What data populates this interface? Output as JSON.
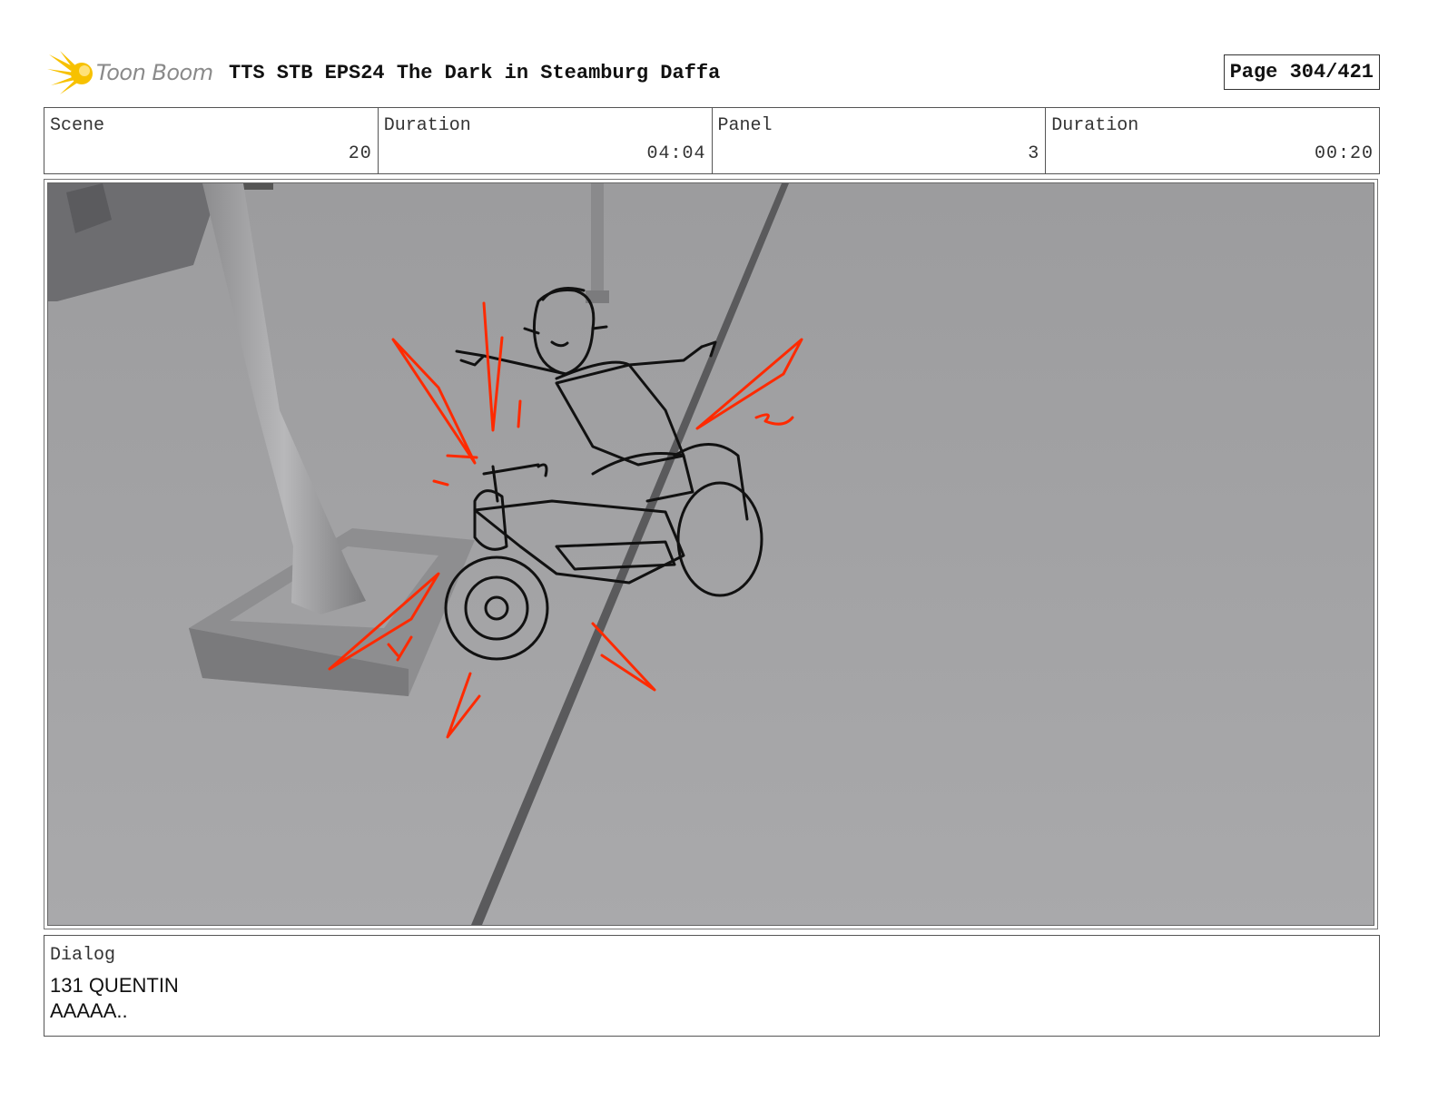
{
  "header": {
    "logo_text": "Toon Boom",
    "title": "TTS STB EPS24 The Dark in Steamburg Daffa",
    "page": "Page 304/421"
  },
  "info": {
    "scene_label": "Scene",
    "scene_value": "20",
    "scene_duration_label": "Duration",
    "scene_duration_value": "04:04",
    "panel_label": "Panel",
    "panel_value": "3",
    "panel_duration_label": "Duration",
    "panel_duration_value": "00:20"
  },
  "dialog": {
    "label": "Dialog",
    "speaker_line": "131 QUENTIN",
    "text": "AAAAA.."
  },
  "colors": {
    "sketch_red": "#ff2a00",
    "ground": "#a7a7a9",
    "logo_yellow": "#f7c100"
  }
}
